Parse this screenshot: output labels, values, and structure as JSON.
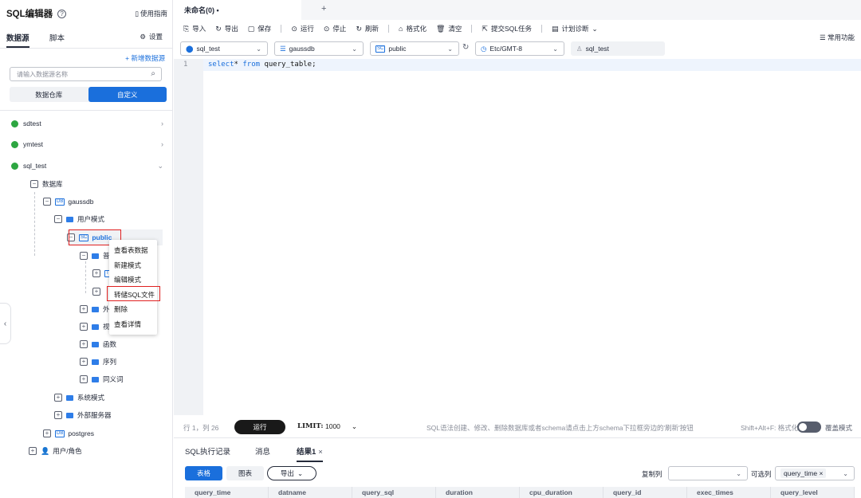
{
  "sidebar": {
    "title": "SQL编辑器",
    "guide": "使用指南",
    "tab_datasource": "数据源",
    "tab_script": "脚本",
    "settings": "设置",
    "add_datasource": "+ 新增数据源",
    "search_placeholder": "请输入数据源名称",
    "seg_warehouse": "数据仓库",
    "seg_custom": "自定义",
    "datasources": [
      "sdtest",
      "ymtest",
      "sql_test"
    ],
    "tree": {
      "database": "数据库",
      "gaussdb": "gaussdb",
      "user_schema": "用户模式",
      "public": "public",
      "normal_partial": "普通",
      "external_partial": "外",
      "view_partial": "视",
      "functions": "函数",
      "sequences": "序列",
      "synonyms": "同义词",
      "system_schema": "系统模式",
      "external_servers": "外部服务器",
      "postgres": "postgres",
      "users_roles": "用户/角色"
    }
  },
  "context_menu": [
    "查看表数据",
    "新建模式",
    "编辑模式",
    "转储SQL文件",
    "删除",
    "查看详情"
  ],
  "editor": {
    "file_tab": "未命名(0) •",
    "toolbar": [
      "导入",
      "导出",
      "保存",
      "运行",
      "停止",
      "刷新",
      "格式化",
      "清空",
      "提交SQL任务",
      "计划诊断"
    ],
    "common_functions": "常用功能",
    "selects": {
      "datasource": "sql_test",
      "database": "gaussdb",
      "schema": "public",
      "timezone": "Etc/GMT-8",
      "user": "sql_test"
    },
    "line_number": "1",
    "code_kw1": "select",
    "code_mid": "* ",
    "code_kw2": "from",
    "code_rest": " query_table;"
  },
  "status": {
    "position": "行 1，列 26",
    "run": "运行",
    "limit_label": "LIMIT:",
    "limit_value": "1000",
    "hint": "SQL语法创建、修改、删除数据库或者schema请点击上方schema下拉框旁边的'刷新'按钮",
    "format_shortcut": "Shift+Alt+F: 格式化",
    "overwrite_mode": "覆盖模式"
  },
  "results": {
    "tabs": [
      "SQL执行记录",
      "消息",
      "结果1"
    ],
    "view_table": "表格",
    "view_chart": "图表",
    "export": "导出",
    "copy_column": "复制列",
    "optional_columns": "可选列",
    "selected_column": "query_time",
    "columns": [
      "query_time",
      "datname",
      "query_sql",
      "duration",
      "cpu_duration",
      "query_id",
      "exec_times",
      "query_level"
    ]
  },
  "colors": {
    "accent": "#1a6fdc",
    "highlight": "#e02020",
    "db_green": "#2da641"
  }
}
